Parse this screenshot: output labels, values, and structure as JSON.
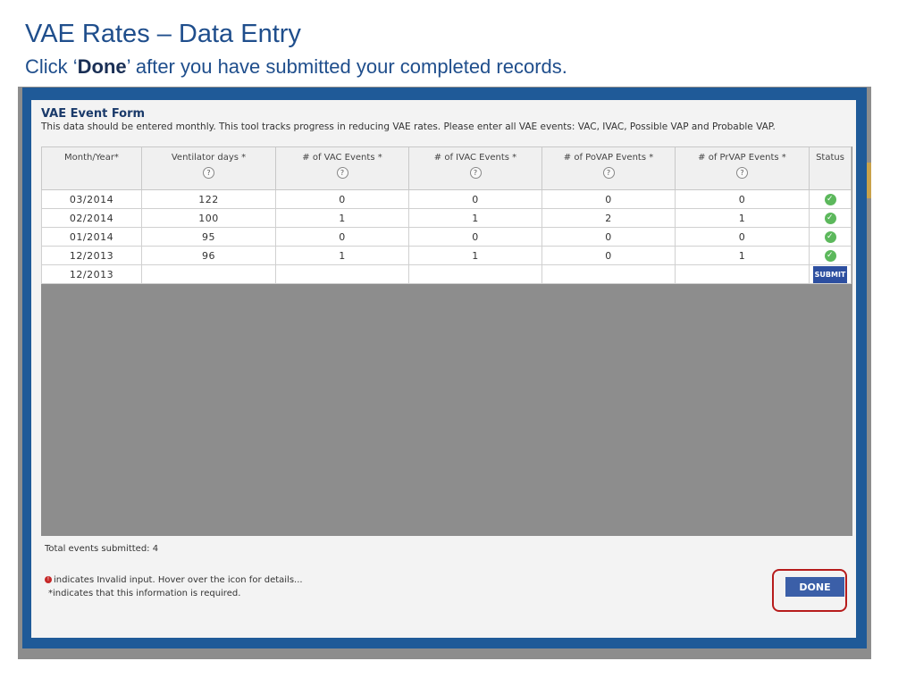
{
  "slide": {
    "title": "VAE Rates – Data Entry",
    "subtitle_pre": "Click ‘",
    "subtitle_bold": "Done",
    "subtitle_post": "’ after you have submitted your completed records."
  },
  "form": {
    "title": "VAE Event Form",
    "description": "This data should be entered monthly. This tool tracks progress in reducing VAE rates. Please enter all VAE events: VAC, IVAC, Possible VAP and Probable VAP.",
    "columns": [
      "Month/Year*",
      "Ventilator days *",
      "# of VAC Events *",
      "# of IVAC Events *",
      "# of PoVAP Events *",
      "# of PrVAP Events *",
      "Status"
    ],
    "help_glyph": "?",
    "rows": [
      {
        "month": "03/2014",
        "vent_days": "122",
        "vac": "0",
        "ivac": "0",
        "povap": "0",
        "prvap": "0",
        "status": "check-icon"
      },
      {
        "month": "02/2014",
        "vent_days": "100",
        "vac": "1",
        "ivac": "1",
        "povap": "2",
        "prvap": "1",
        "status": "check-icon"
      },
      {
        "month": "01/2014",
        "vent_days": "95",
        "vac": "0",
        "ivac": "0",
        "povap": "0",
        "prvap": "0",
        "status": "check-icon"
      },
      {
        "month": "12/2013",
        "vent_days": "96",
        "vac": "1",
        "ivac": "1",
        "povap": "0",
        "prvap": "1",
        "status": "check-icon"
      }
    ],
    "new_row": {
      "month": "12/2013",
      "submit_label": "SUBMIT"
    },
    "total_label": "Total events submitted: 4",
    "legend_invalid": "indicates Invalid input. Hover over the icon for details...",
    "legend_required": "*indicates that this information is required.",
    "done_label": "DONE"
  },
  "colors": {
    "title": "#1f4e8c",
    "modal_frame": "#1f5a98",
    "button": "#3b5fa8",
    "highlight": "#b71c1c",
    "ok": "#5cb85c"
  }
}
